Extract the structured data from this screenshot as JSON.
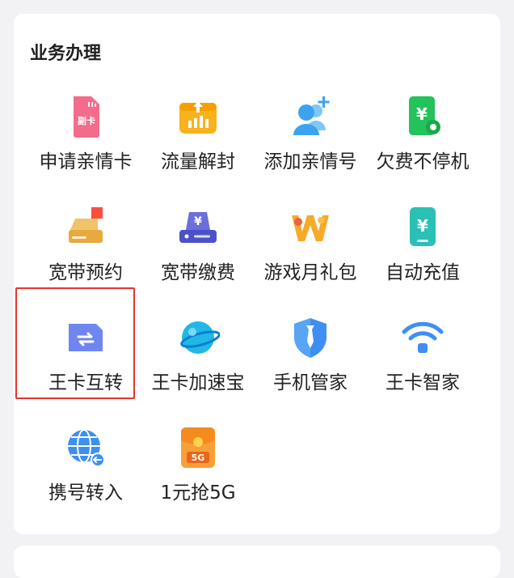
{
  "section": {
    "title": "业务办理"
  },
  "services": [
    {
      "label": "申请亲情卡",
      "icon": "sim-card-icon",
      "badge": "副卡"
    },
    {
      "label": "流量解封",
      "icon": "data-unlock-icon"
    },
    {
      "label": "添加亲情号",
      "icon": "add-contact-icon"
    },
    {
      "label": "欠费不停机",
      "icon": "phone-yuan-icon"
    },
    {
      "label": "宽带预约",
      "icon": "broadband-box-icon"
    },
    {
      "label": "宽带缴费",
      "icon": "router-yuan-icon"
    },
    {
      "label": "游戏月礼包",
      "icon": "game-gift-icon"
    },
    {
      "label": "自动充值",
      "icon": "auto-recharge-icon"
    },
    {
      "label": "王卡互转",
      "icon": "card-transfer-icon"
    },
    {
      "label": "王卡加速宝",
      "icon": "planet-icon"
    },
    {
      "label": "手机管家",
      "icon": "shield-icon"
    },
    {
      "label": "王卡智家",
      "icon": "wifi-icon"
    },
    {
      "label": "携号转入",
      "icon": "globe-transfer-icon"
    },
    {
      "label": "1元抢5G",
      "icon": "5g-envelope-icon",
      "badge": "5G"
    }
  ],
  "selected_index": 8,
  "colors": {
    "selection_border": "#e8342d",
    "background": "#f2f2f4"
  }
}
